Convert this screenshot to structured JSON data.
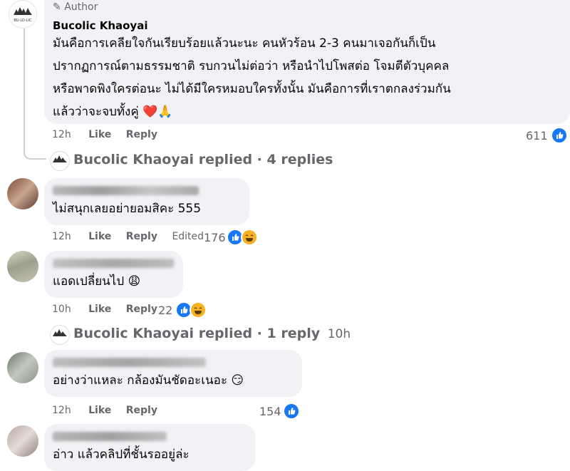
{
  "author_comment": {
    "badge": "Author",
    "name": "Bucolic Khaoyai",
    "avatar_text": "BU-LO-LIC",
    "lines": [
      "มันคือการเคลียใจกันเรียบร้อยแล้วนะนะ คนหัวร้อน 2-3 คนมาเจอกันก็เป็น",
      "ปรากฏการณ์ตามธรรมชาติ รบกวนไม่ต่อว่า หรือนำไปโพสต่อ โจมตีตัวบุคคล",
      "หรือพาดพิงใครต่อนะ ไม่ได้มีใครหมอบใครทั้งนั้น มันคือการที่เราตกลงร่วมกัน",
      "แล้วว่าจะจบทั้งคู่ ❤️🙏"
    ],
    "time": "12h",
    "like": "Like",
    "reply": "Reply",
    "reaction_count": "611"
  },
  "replies_summary_1": {
    "name": "Bucolic Khaoyai",
    "text": " replied · 4 replies"
  },
  "comments": [
    {
      "text": "ไม่สนุกเลยอย่ายอมสิคะ 555",
      "time": "12h",
      "like": "Like",
      "reply": "Reply",
      "edited": "Edited",
      "reaction_count": "176"
    },
    {
      "text": "แอดเปลี่ยนไป 😩",
      "time": "10h",
      "like": "Like",
      "reply": "Reply",
      "reaction_count": "22"
    },
    {
      "text": "อย่างว่าแหละ กล้องมันชัดอะเนอะ 😏",
      "time": "12h",
      "like": "Like",
      "reply": "Reply",
      "reaction_count": "154"
    },
    {
      "text": "อ่าว แล้วคลิปที่ชั้นรออยู่ล่ะ"
    }
  ],
  "replies_summary_2": {
    "name": "Bucolic Khaoyai",
    "text": " replied · 1 reply",
    "time": "10h"
  },
  "colors": {
    "bubble": "#f0f2f5",
    "like_blue": "#1877f2",
    "haha_yellow": "#f7b125",
    "heart_red": "#e41e3f",
    "meta_gray": "#65676b"
  }
}
